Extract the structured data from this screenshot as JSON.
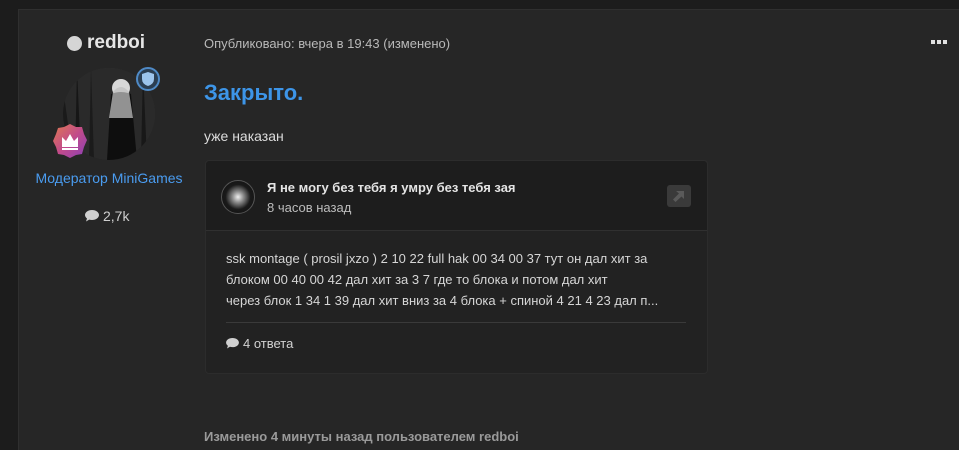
{
  "author": {
    "name": "redboi",
    "role": "Модератор MiniGames",
    "reactions": "2,7k"
  },
  "post": {
    "meta": "Опубликовано: вчера в 19:43 (изменено)",
    "title": "Закрыто.",
    "body": "уже наказан",
    "edited_note": "Изменено 4 минуты назад пользователем redboi"
  },
  "quote": {
    "title": "Я не могу без тебя я умру без тебя зая",
    "time": "8 часов назад",
    "snippet_lines": [
      "ssk montage ( prosil jxzo ) 2 10 22 full hak 00 34 00 37 тут он дал хит за",
      "блоком 00 40 00 42 дал хит за 3 7 где то блока и потом дал хит",
      "через блок 1 34 1 39 дал хит вниз за 4 блока + спиной 4 21 4 23 дал п..."
    ],
    "replies": "4 ответа"
  },
  "colors": {
    "accent": "#3d95e8",
    "role": "#4a9cf0",
    "background": "#262626"
  },
  "icons": {
    "online": "online-dot-icon",
    "shield": "shield-icon",
    "rank": "crown-icon",
    "reactions": "comment-icon",
    "more": "more-icon",
    "open": "external-link-icon",
    "replies": "comment-icon"
  }
}
